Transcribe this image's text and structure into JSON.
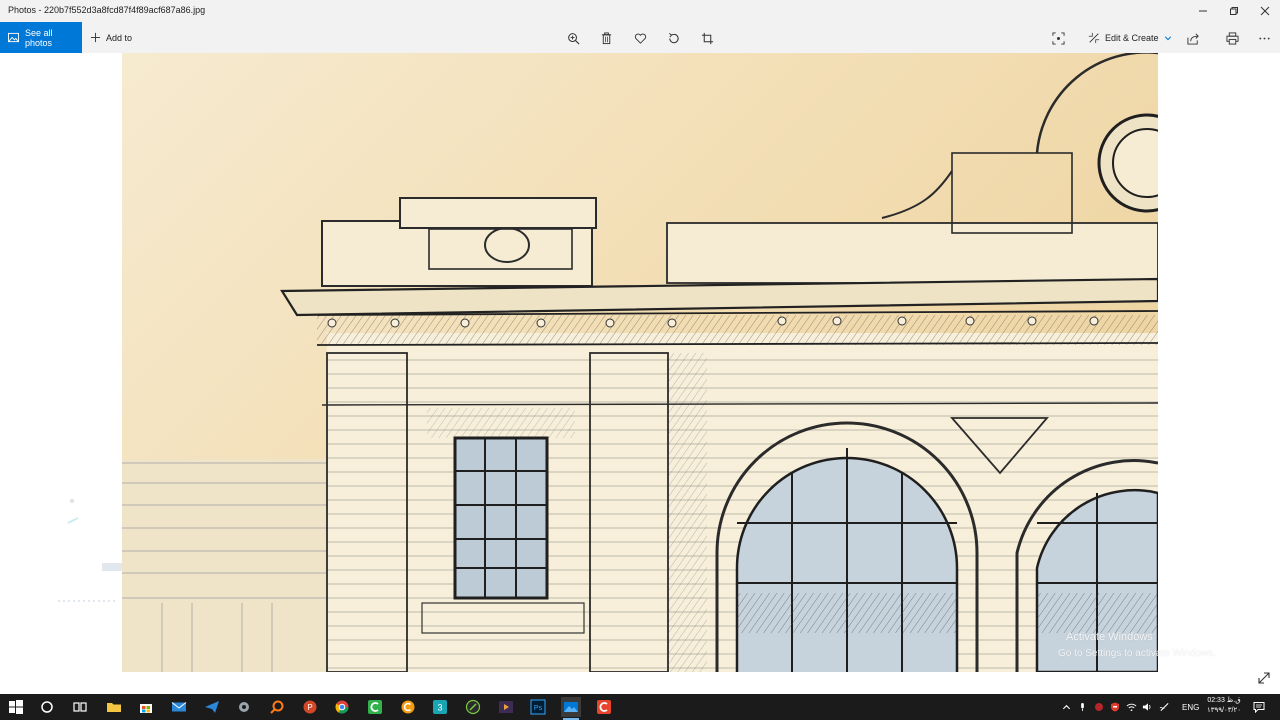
{
  "window": {
    "title": "Photos - 220b7f552d3a8fcd87f4f89acf687a86.jpg"
  },
  "toolbar": {
    "see_all_label": "See all photos",
    "add_to_label": "Add to",
    "edit_create_label": "Edit & Create"
  },
  "overlay": {
    "activate_title": "Activate Windows",
    "activate_sub": "Go to Settings to activate Windows."
  },
  "taskbar": {
    "lang": "ENG",
    "time": "02:33 ق.ظ",
    "date": "۱۳۹۹/۰۳/۲۰"
  },
  "colors": {
    "accent": "#0078d7",
    "taskbar": "#1b1b1b",
    "paper": "#f3e6c8"
  }
}
